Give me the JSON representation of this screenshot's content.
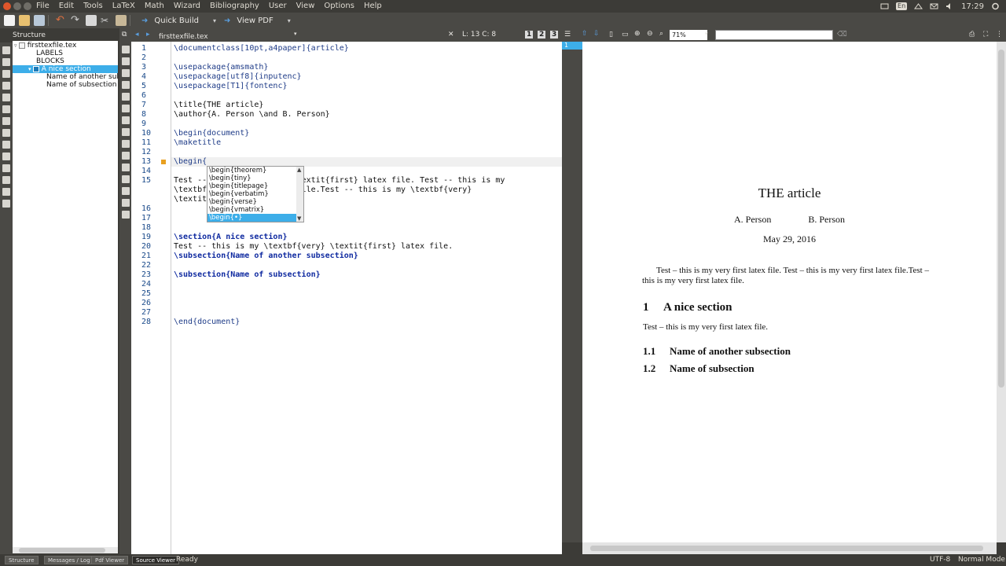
{
  "menu": {
    "items": [
      "File",
      "Edit",
      "Tools",
      "LaTeX",
      "Math",
      "Wizard",
      "Bibliography",
      "User",
      "View",
      "Options",
      "Help"
    ]
  },
  "indicators": {
    "language": "En",
    "clock": "17:29"
  },
  "toolbar": {
    "quick_build": "Quick Build",
    "view_pdf": "View PDF"
  },
  "structure": {
    "title": "Structure",
    "items": [
      "firsttexfile.tex",
      "LABELS",
      "BLOCKS",
      "A nice section",
      "Name of another subsection",
      "Name of subsection"
    ]
  },
  "editor": {
    "filename": "firsttexfile.tex",
    "position": "L: 13 C: 8",
    "line_numbers": [
      "1",
      "2",
      "3",
      "4",
      "5",
      "6",
      "7",
      "8",
      "9",
      "10",
      "11",
      "12",
      "13",
      "14",
      "15",
      "16",
      "17",
      "18",
      "19",
      "20",
      "21",
      "22",
      "23",
      "24",
      "25",
      "26",
      "27",
      "28"
    ],
    "code": {
      "l1": "\\documentclass[10pt,a4paper]{article}",
      "l3": "\\usepackage{amsmath}",
      "l4": "\\usepackage[utf8]{inputenc}",
      "l5": "\\usepackage[T1]{fontenc}",
      "l7": "\\title{THE article}",
      "l8": "\\author{A. Person \\and B. Person}",
      "l10": "\\begin{document}",
      "l11": "\\maketitle",
      "l13": "\\begin{",
      "l15a": "Test --            very} \\textit{first} latex file. Test -- this is my",
      "l15b": "\\textbf          -- latex file.Test -- this is my \\textbf{very}",
      "l15c": "\\textit",
      "l19": "\\section{A nice section}",
      "l20": "Test -- this is my \\textbf{very} \\textit{first} latex file.",
      "l21": "\\subsection{Name of another subsection}",
      "l23": "\\subsection{Name of subsection}",
      "l28": "\\end{document}"
    }
  },
  "completer": {
    "items": [
      "\\begin{theorem}",
      "\\begin{tiny}",
      "\\begin{titlepage}",
      "\\begin{verbatim}",
      "\\begin{verse}",
      "\\begin{vmatrix}",
      "\\begin{•}"
    ]
  },
  "pdf": {
    "zoom": "71%",
    "page_number": "1",
    "title": "THE article",
    "author1": "A. Person",
    "author2": "B. Person",
    "date": "May 29, 2016",
    "para": "Test – this is my very first latex file. Test – this is my very first latex file.Test – this is my very first latex file.",
    "section_num": "1",
    "section_title": "A nice section",
    "section_text": "Test – this is my very first latex file.",
    "sub1_num": "1.1",
    "sub1_title": "Name of another subsection",
    "sub2_num": "1.2",
    "sub2_title": "Name of subsection"
  },
  "statusbar": {
    "tabs": [
      "Structure",
      "Messages / Log",
      "Pdf Viewer",
      "Source Viewer"
    ],
    "status": "Ready",
    "encoding": "UTF-8",
    "mode": "Normal Mode"
  },
  "colors": {
    "accent": "#3daee9",
    "keyword": "#1f3c88",
    "section": "#0f2aa0"
  }
}
